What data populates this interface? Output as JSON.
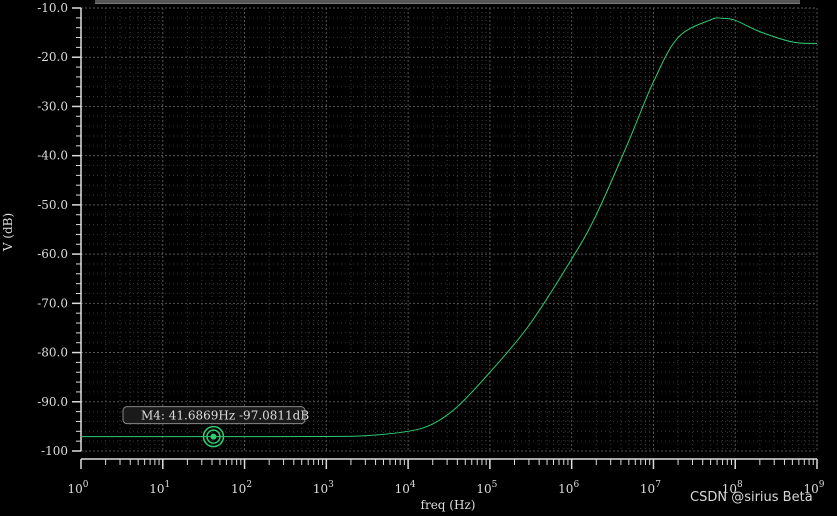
{
  "chart_data": {
    "type": "line",
    "xlabel": "freq (Hz)",
    "ylabel": "V (dB)",
    "xscale": "log",
    "xlim": [
      1,
      1000000000
    ],
    "ylim": [
      -100,
      -10
    ],
    "x_ticks": [
      "10^0",
      "10^1",
      "10^2",
      "10^3",
      "10^4",
      "10^5",
      "10^6",
      "10^7",
      "10^8",
      "10^9"
    ],
    "y_ticks": [
      "-10.0",
      "-20.0",
      "-30.0",
      "-40.0",
      "-50.0",
      "-60.0",
      "-70.0",
      "-80.0",
      "-90.0",
      "-100"
    ],
    "grid": true,
    "series": [
      {
        "color": "#2ecc71",
        "x": [
          1,
          10,
          100,
          1000,
          3000,
          10000,
          20000,
          40000,
          100000,
          300000,
          1000000,
          2000000,
          5000000,
          10000000,
          20000000,
          50000000,
          70000000,
          100000000,
          200000000,
          500000000,
          1000000000
        ],
        "y": [
          -97.08,
          -97.08,
          -97.08,
          -97.05,
          -96.9,
          -96.0,
          -94.5,
          -91.0,
          -84.0,
          -74.5,
          -61.0,
          -52.0,
          -37.0,
          -25.0,
          -16.0,
          -12.4,
          -12.1,
          -12.5,
          -14.8,
          -16.9,
          -17.2
        ]
      }
    ],
    "marker": {
      "name": "M4",
      "label": "M4: 41.6869Hz -97.0811dB",
      "x": 41.6869,
      "y": -97.0811,
      "color": "#2ecc71"
    }
  },
  "watermark": "CSDN @sirius Beta"
}
